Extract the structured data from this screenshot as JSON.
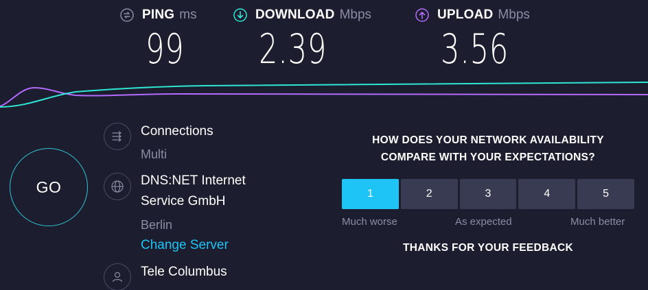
{
  "metrics": {
    "ping": {
      "label": "PING",
      "unit": "ms",
      "value": "99",
      "icon": "ping-icon",
      "color": "#8b8da3"
    },
    "download": {
      "label": "DOWNLOAD",
      "unit": "Mbps",
      "value": "2.39",
      "icon": "download-icon",
      "color": "#2ee8d6"
    },
    "upload": {
      "label": "UPLOAD",
      "unit": "Mbps",
      "value": "3.56",
      "icon": "upload-icon",
      "color": "#b36cff"
    }
  },
  "go": {
    "label": "GO"
  },
  "connections": {
    "label": "Connections",
    "value": "Multi",
    "icon": "connections-icon"
  },
  "server": {
    "name_line1": "DNS:NET Internet",
    "name_line2": "Service GmbH",
    "location": "Berlin",
    "change_label": "Change Server",
    "icon": "globe-icon"
  },
  "provider": {
    "name": "Tele Columbus",
    "icon": "user-icon"
  },
  "feedback": {
    "question_line1": "HOW DOES YOUR NETWORK AVAILABILITY",
    "question_line2": "COMPARE WITH YOUR EXPECTATIONS?",
    "options": [
      "1",
      "2",
      "3",
      "4",
      "5"
    ],
    "selected": "1",
    "scale_low": "Much worse",
    "scale_mid": "As expected",
    "scale_high": "Much better",
    "thanks": "THANKS FOR YOUR FEEDBACK"
  },
  "colors": {
    "background": "#1c1d2f",
    "accent": "#1ec4f5",
    "download_line": "#2ee8d6",
    "upload_line": "#b36cff"
  }
}
